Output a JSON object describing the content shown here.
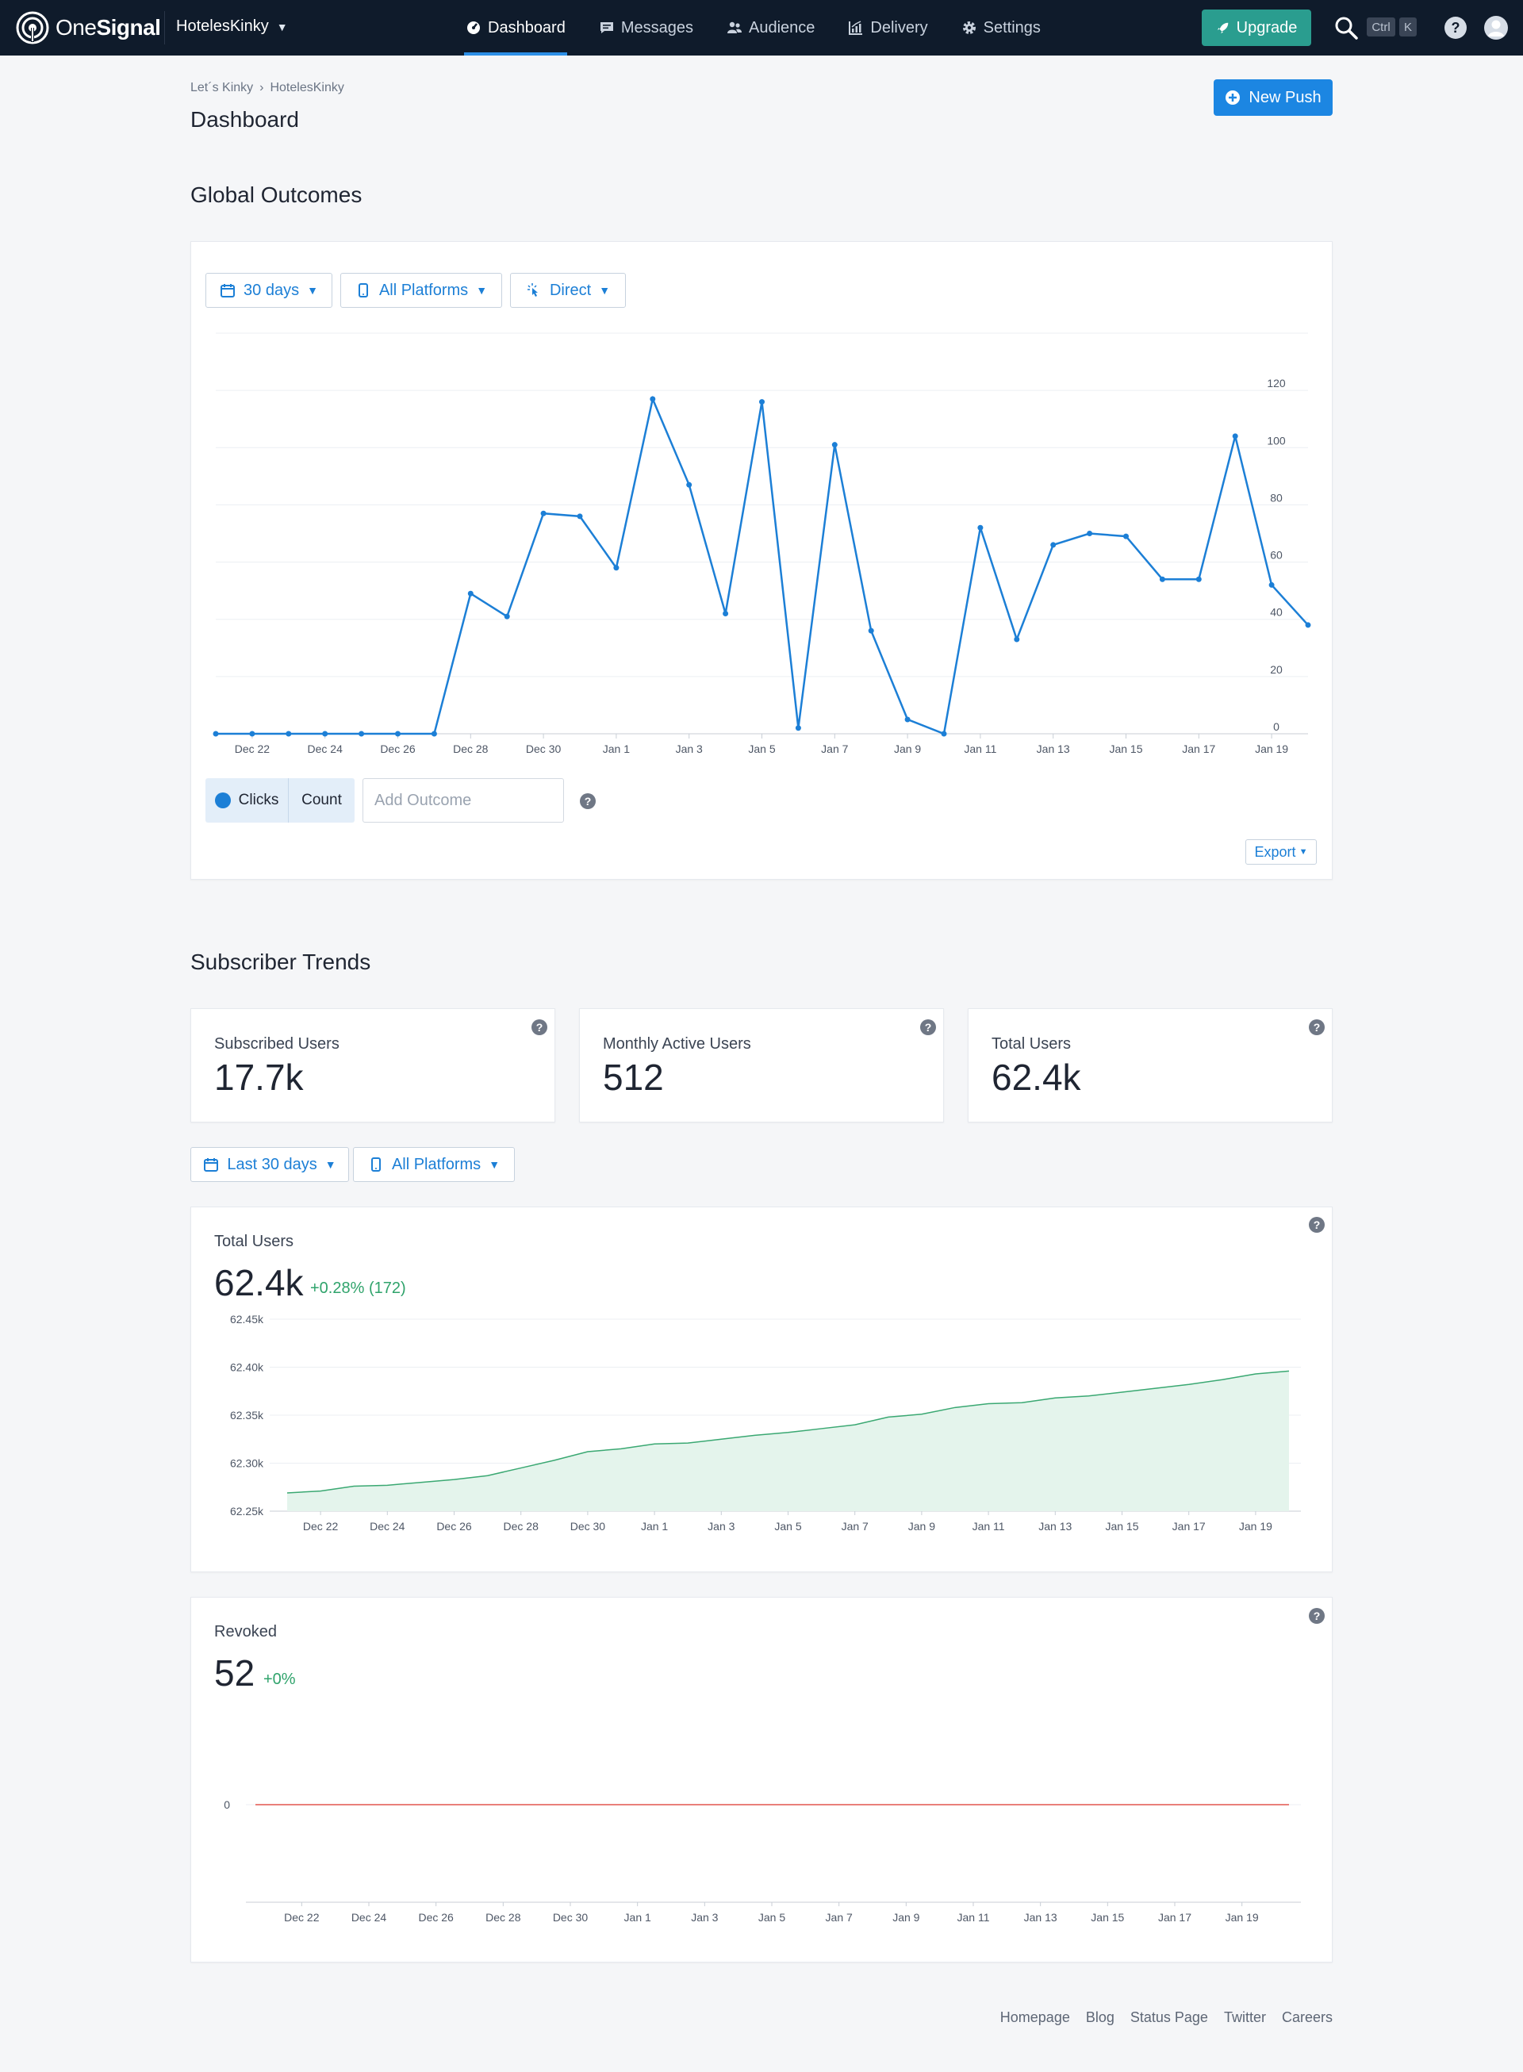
{
  "brand": {
    "logo_text_light": "One",
    "logo_text_bold": "Signal",
    "accent": "#1c86e2",
    "nav_bg": "#0f1b2b",
    "upgrade_bg": "#2a9d8f"
  },
  "app": {
    "name": "HotelesKinky"
  },
  "nav": {
    "tabs": [
      {
        "label": "Dashboard",
        "icon": "dashboard-gauge-icon",
        "active": true
      },
      {
        "label": "Messages",
        "icon": "messages-icon",
        "active": false
      },
      {
        "label": "Audience",
        "icon": "audience-icon",
        "active": false
      },
      {
        "label": "Delivery",
        "icon": "delivery-chart-icon",
        "active": false
      },
      {
        "label": "Settings",
        "icon": "gear-icon",
        "active": false
      }
    ],
    "upgrade_label": "Upgrade",
    "shortcut_keys": [
      "Ctrl",
      "K"
    ]
  },
  "breadcrumb": [
    "Let´s Kinky",
    "HotelesKinky"
  ],
  "page_title": "Dashboard",
  "new_push_label": "New Push",
  "global_outcomes": {
    "title": "Global Outcomes",
    "filters": {
      "range": "30 days",
      "platform": "All Platforms",
      "attribution": "Direct"
    },
    "outcome": {
      "name": "Clicks",
      "type": "Count"
    },
    "add_outcome_placeholder": "Add Outcome",
    "export_label": "Export"
  },
  "subscriber_trends": {
    "title": "Subscriber Trends",
    "stats": [
      {
        "label": "Subscribed Users",
        "value": "17.7k"
      },
      {
        "label": "Monthly Active Users",
        "value": "512"
      },
      {
        "label": "Total Users",
        "value": "62.4k"
      }
    ],
    "filters": {
      "range": "Last 30 days",
      "platform": "All Platforms"
    },
    "total_users": {
      "label": "Total Users",
      "value": "62.4k",
      "delta": "+0.28% (172)"
    },
    "revoked": {
      "label": "Revoked",
      "value": "52",
      "delta": "+0%"
    }
  },
  "footer_links": [
    "Homepage",
    "Blog",
    "Status Page",
    "Twitter",
    "Careers"
  ],
  "chart_data": [
    {
      "type": "line",
      "x": [
        "Dec 21",
        "Dec 22",
        "Dec 23",
        "Dec 24",
        "Dec 25",
        "Dec 26",
        "Dec 27",
        "Dec 28",
        "Dec 29",
        "Dec 30",
        "Dec 31",
        "Jan 1",
        "Jan 2",
        "Jan 3",
        "Jan 4",
        "Jan 5",
        "Jan 6",
        "Jan 7",
        "Jan 8",
        "Jan 9",
        "Jan 10",
        "Jan 11",
        "Jan 12",
        "Jan 13",
        "Jan 14",
        "Jan 15",
        "Jan 16",
        "Jan 17",
        "Jan 18",
        "Jan 19",
        "Jan 20"
      ],
      "tick_labels": [
        "Dec 22",
        "Dec 24",
        "Dec 26",
        "Dec 28",
        "Dec 30",
        "Jan 1",
        "Jan 3",
        "Jan 5",
        "Jan 7",
        "Jan 9",
        "Jan 11",
        "Jan 13",
        "Jan 15",
        "Jan 17",
        "Jan 19"
      ],
      "series": [
        {
          "name": "Clicks",
          "values": [
            0,
            0,
            0,
            0,
            0,
            0,
            0,
            49,
            41,
            77,
            76,
            58,
            117,
            87,
            42,
            116,
            2,
            101,
            36,
            5,
            0,
            72,
            33,
            66,
            70,
            69,
            54,
            54,
            104,
            52,
            38
          ]
        }
      ],
      "ylim": [
        0,
        140
      ],
      "yticks": [
        0,
        20,
        40,
        60,
        80,
        100,
        120
      ],
      "axis_side": "right",
      "color": "#1c7fd6",
      "grid": true
    },
    {
      "type": "area",
      "x": [
        "Dec 21",
        "Dec 22",
        "Dec 23",
        "Dec 24",
        "Dec 25",
        "Dec 26",
        "Dec 27",
        "Dec 28",
        "Dec 29",
        "Dec 30",
        "Dec 31",
        "Jan 1",
        "Jan 2",
        "Jan 3",
        "Jan 4",
        "Jan 5",
        "Jan 6",
        "Jan 7",
        "Jan 8",
        "Jan 9",
        "Jan 10",
        "Jan 11",
        "Jan 12",
        "Jan 13",
        "Jan 14",
        "Jan 15",
        "Jan 16",
        "Jan 17",
        "Jan 18",
        "Jan 19",
        "Jan 20"
      ],
      "tick_labels": [
        "Dec 22",
        "Dec 24",
        "Dec 26",
        "Dec 28",
        "Dec 30",
        "Jan 1",
        "Jan 3",
        "Jan 5",
        "Jan 7",
        "Jan 9",
        "Jan 11",
        "Jan 13",
        "Jan 15",
        "Jan 17",
        "Jan 19"
      ],
      "series": [
        {
          "name": "Total Users",
          "values": [
            62269,
            62271,
            62276,
            62277,
            62280,
            62283,
            62287,
            62295,
            62303,
            62312,
            62315,
            62320,
            62321,
            62325,
            62329,
            62332,
            62336,
            62340,
            62348,
            62351,
            62358,
            62362,
            62363,
            62368,
            62370,
            62374,
            62378,
            62382,
            62387,
            62393,
            62396
          ]
        }
      ],
      "ylim": [
        62250,
        62450
      ],
      "yticks": [
        "62.25k",
        "62.30k",
        "62.35k",
        "62.40k",
        "62.45k"
      ],
      "color": "#3aa872",
      "fill": "#e4f4ec",
      "grid": true
    },
    {
      "type": "line",
      "x": [
        "Dec 21",
        "Dec 22",
        "Dec 23",
        "Dec 24",
        "Dec 25",
        "Dec 26",
        "Dec 27",
        "Dec 28",
        "Dec 29",
        "Dec 30",
        "Dec 31",
        "Jan 1",
        "Jan 2",
        "Jan 3",
        "Jan 4",
        "Jan 5",
        "Jan 6",
        "Jan 7",
        "Jan 8",
        "Jan 9",
        "Jan 10",
        "Jan 11",
        "Jan 12",
        "Jan 13",
        "Jan 14",
        "Jan 15",
        "Jan 16",
        "Jan 17",
        "Jan 18",
        "Jan 19",
        "Jan 20"
      ],
      "tick_labels": [
        "Dec 22",
        "Dec 24",
        "Dec 26",
        "Dec 28",
        "Dec 30",
        "Jan 1",
        "Jan 3",
        "Jan 5",
        "Jan 7",
        "Jan 9",
        "Jan 11",
        "Jan 13",
        "Jan 15",
        "Jan 17",
        "Jan 19"
      ],
      "series": [
        {
          "name": "Revoked",
          "values": [
            0,
            0,
            0,
            0,
            0,
            0,
            0,
            0,
            0,
            0,
            0,
            0,
            0,
            0,
            0,
            0,
            0,
            0,
            0,
            0,
            0,
            0,
            0,
            0,
            0,
            0,
            0,
            0,
            0,
            0,
            0
          ]
        }
      ],
      "yticks": [
        0
      ],
      "color": "#e4574f",
      "grid": true
    }
  ]
}
